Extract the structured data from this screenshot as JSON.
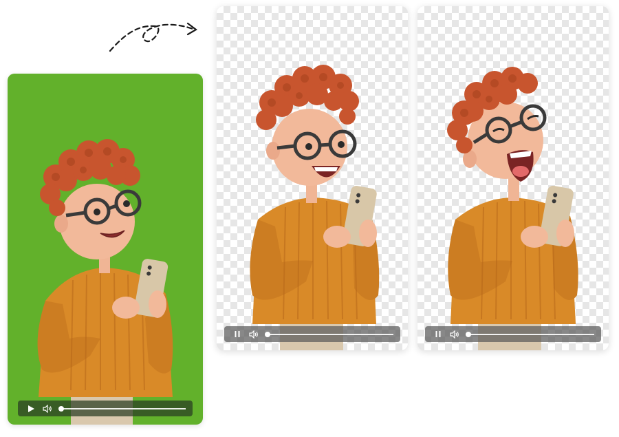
{
  "cards": [
    {
      "kind": "original-video",
      "background": "#62b12b",
      "expression": "smiling",
      "playback_state": "paused",
      "control_button": "play-icon",
      "progress": 0
    },
    {
      "kind": "background-removed-video",
      "background": "transparent-checkerboard",
      "expression": "laughing",
      "playback_state": "playing",
      "control_button": "pause-icon",
      "progress": 0
    },
    {
      "kind": "background-removed-video",
      "background": "transparent-checkerboard",
      "expression": "laughing-eyes-closed",
      "playback_state": "playing",
      "control_button": "pause-icon",
      "progress": 0
    }
  ],
  "icons": {
    "play": "play-icon",
    "pause": "pause-icon",
    "volume": "volume-icon",
    "arrow": "dashed-arrow-icon"
  },
  "colors": {
    "green_screen": "#62b12b",
    "hair": "#c8552e",
    "sweater": "#d98a28",
    "skin": "#f2b99a",
    "phone": "#d8c7a8"
  }
}
